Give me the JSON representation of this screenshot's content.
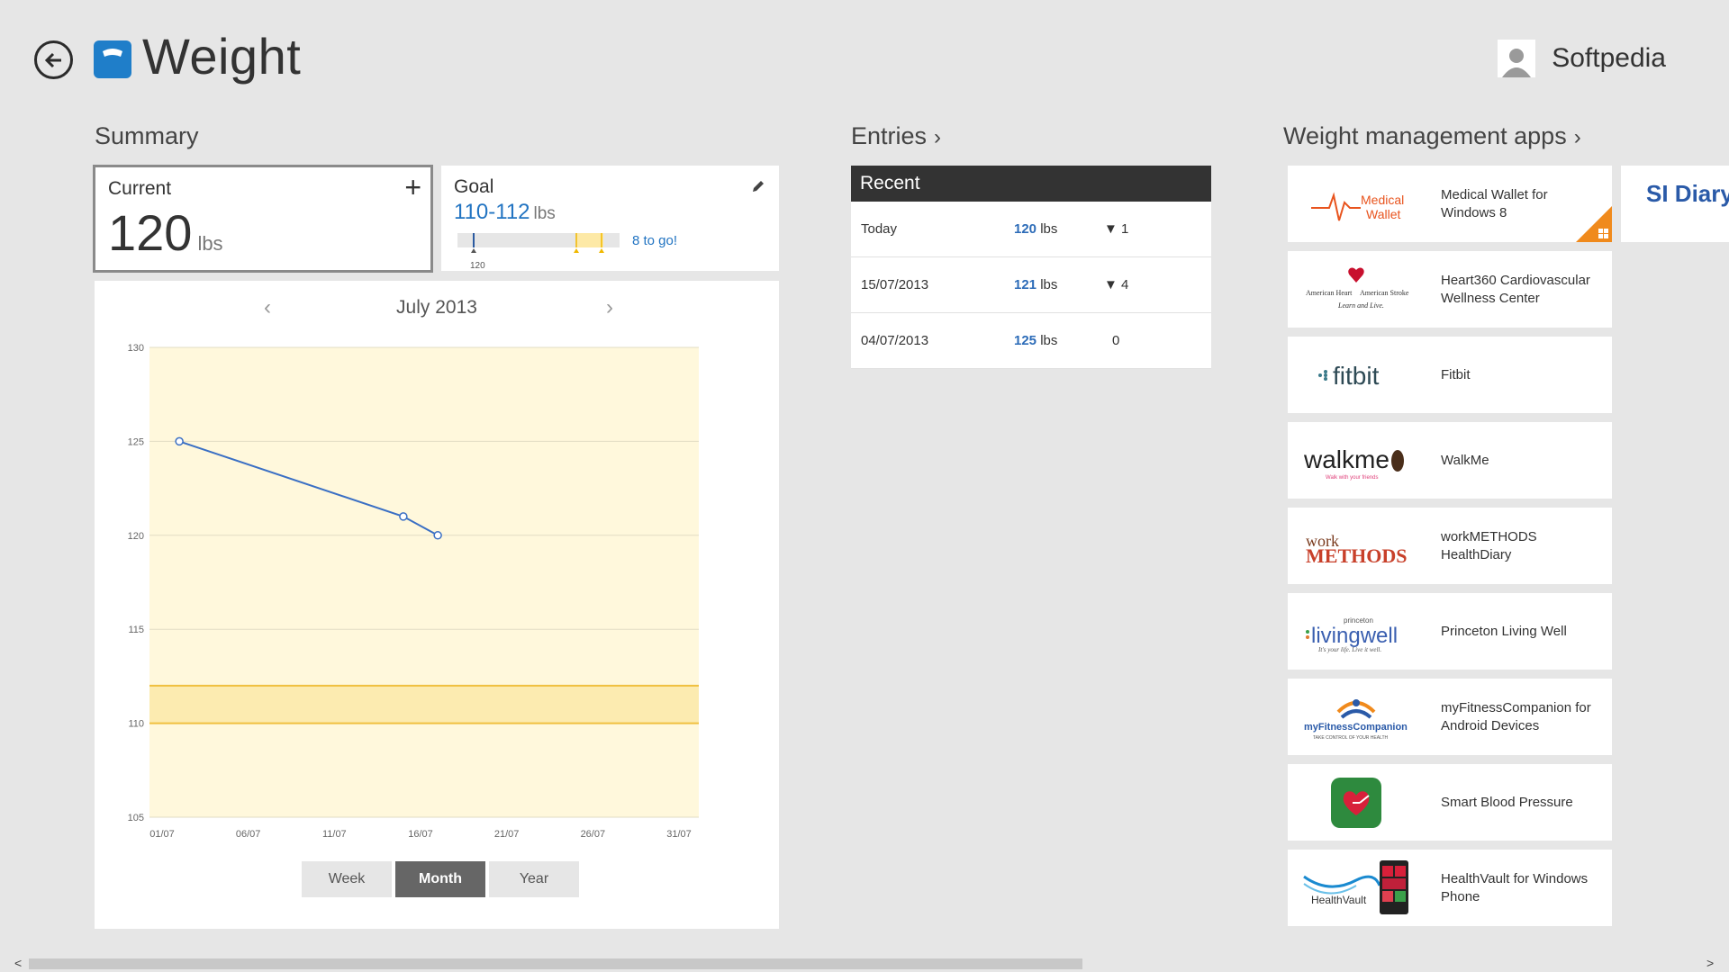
{
  "header": {
    "title": "Weight",
    "user_name": "Softpedia"
  },
  "summary": {
    "title": "Summary",
    "current": {
      "label": "Current",
      "value": "120",
      "unit": "lbs"
    },
    "goal": {
      "label": "Goal",
      "range": "110-112",
      "unit": "lbs",
      "to_go": "8 to go!",
      "marker": "120"
    },
    "month_label": "July 2013",
    "range_buttons": [
      "Week",
      "Month",
      "Year"
    ],
    "active_range": "Month"
  },
  "chart_data": {
    "type": "line",
    "x": [
      "02/07",
      "15/07",
      "17/07"
    ],
    "x_tick_labels": [
      "01/07",
      "06/07",
      "11/07",
      "16/07",
      "21/07",
      "26/07",
      "31/07"
    ],
    "series": [
      {
        "values": [
          125,
          121,
          120
        ]
      }
    ],
    "y_ticks": [
      105,
      110,
      115,
      120,
      125,
      130
    ],
    "ylim": [
      105,
      130
    ],
    "goal_band": [
      110,
      112
    ],
    "grid": true,
    "colors": {
      "line": "#3a6fc4",
      "background": "#fff8dc",
      "goal_line": "#f0c040",
      "goal_band": "#fcebb0"
    }
  },
  "entries": {
    "title": "Entries",
    "header": "Recent",
    "rows": [
      {
        "date": "Today",
        "value": "120",
        "unit": "lbs",
        "diff": "▼ 1"
      },
      {
        "date": "15/07/2013",
        "value": "121",
        "unit": "lbs",
        "diff": "▼ 4"
      },
      {
        "date": "04/07/2013",
        "value": "125",
        "unit": "lbs",
        "diff": "0"
      }
    ]
  },
  "apps": {
    "title": "Weight management apps",
    "items": [
      {
        "name": "Medical Wallet for Windows 8",
        "logo": "Medical Wallet"
      },
      {
        "name": "Heart360 Cardiovascular Wellness Center",
        "logo": "American Heart Association"
      },
      {
        "name": "Fitbit",
        "logo": "fitbit"
      },
      {
        "name": "WalkMe",
        "logo": "walkme"
      },
      {
        "name": "workMETHODS HealthDiary",
        "logo": "work METHODS"
      },
      {
        "name": "Princeton Living Well",
        "logo": "livingwell"
      },
      {
        "name": "myFitnessCompanion for Android Devices",
        "logo": "myFitnessCompanion"
      },
      {
        "name": "Smart Blood Pressure",
        "logo": "heart-icon"
      },
      {
        "name": "HealthVault for Windows Phone",
        "logo": "HealthVault"
      }
    ],
    "partial_tile_text": "SI Diary"
  },
  "colors": {
    "accent": "#2274c2",
    "background": "#e6e6e6",
    "header_dark": "#333333"
  }
}
